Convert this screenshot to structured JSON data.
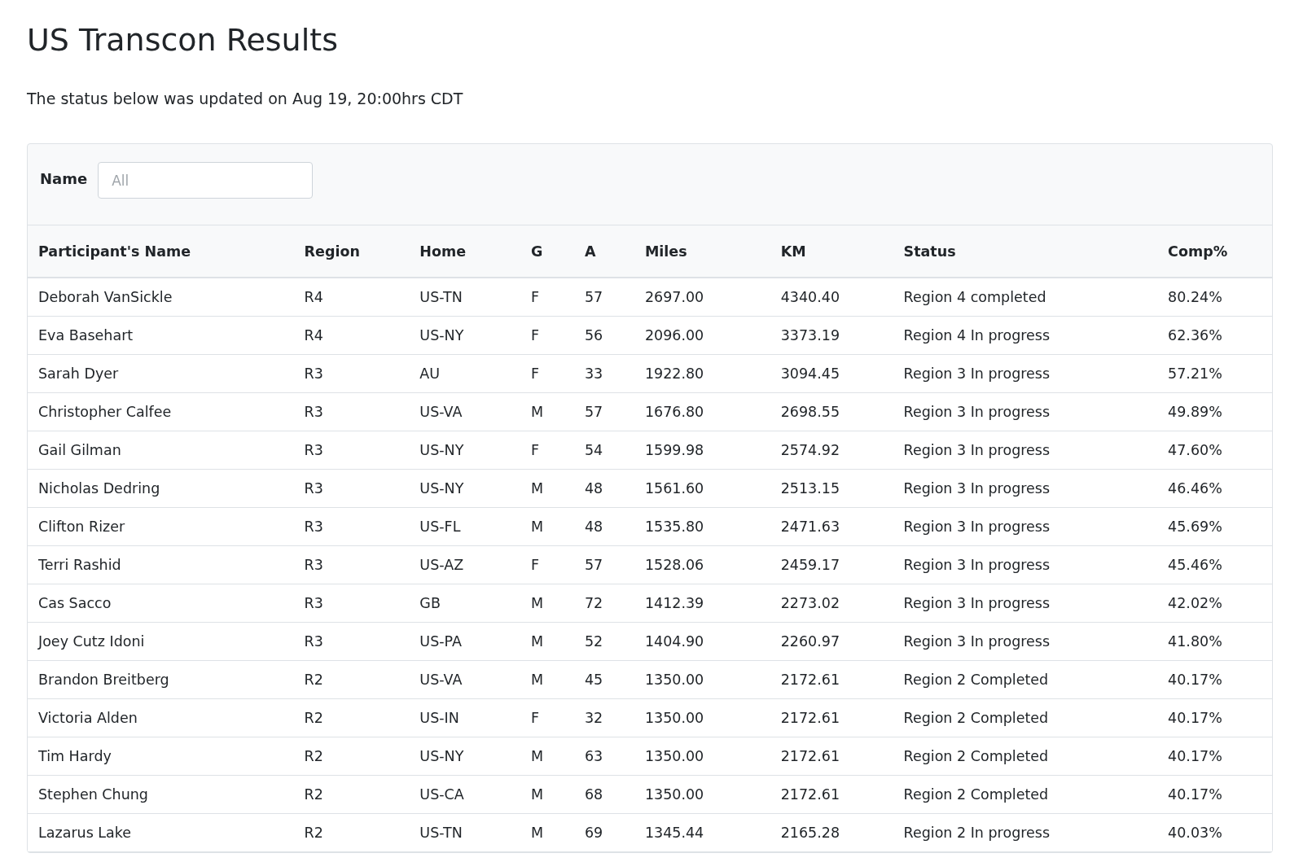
{
  "title": "US Transcon Results",
  "subtitle": "The status below was updated on Aug 19, 20:00hrs CDT",
  "filter": {
    "label": "Name",
    "placeholder": "All"
  },
  "table": {
    "columns": [
      "Participant's Name",
      "Region",
      "Home",
      "G",
      "A",
      "Miles",
      "KM",
      "Status",
      "Comp%"
    ],
    "rows": [
      [
        "Deborah VanSickle",
        "R4",
        "US-TN",
        "F",
        "57",
        "2697.00",
        "4340.40",
        "Region 4 completed",
        "80.24%"
      ],
      [
        "Eva Basehart",
        "R4",
        "US-NY",
        "F",
        "56",
        "2096.00",
        "3373.19",
        "Region 4 In progress",
        "62.36%"
      ],
      [
        "Sarah Dyer",
        "R3",
        "AU",
        "F",
        "33",
        "1922.80",
        "3094.45",
        "Region 3 In progress",
        "57.21%"
      ],
      [
        "Christopher Calfee",
        "R3",
        "US-VA",
        "M",
        "57",
        "1676.80",
        "2698.55",
        "Region 3 In progress",
        "49.89%"
      ],
      [
        "Gail Gilman",
        "R3",
        "US-NY",
        "F",
        "54",
        "1599.98",
        "2574.92",
        "Region 3 In progress",
        "47.60%"
      ],
      [
        "Nicholas Dedring",
        "R3",
        "US-NY",
        "M",
        "48",
        "1561.60",
        "2513.15",
        "Region 3 In progress",
        "46.46%"
      ],
      [
        "Clifton Rizer",
        "R3",
        "US-FL",
        "M",
        "48",
        "1535.80",
        "2471.63",
        "Region 3 In progress",
        "45.69%"
      ],
      [
        "Terri Rashid",
        "R3",
        "US-AZ",
        "F",
        "57",
        "1528.06",
        "2459.17",
        "Region 3 In progress",
        "45.46%"
      ],
      [
        "Cas Sacco",
        "R3",
        "GB",
        "M",
        "72",
        "1412.39",
        "2273.02",
        "Region 3 In progress",
        "42.02%"
      ],
      [
        "Joey Cutz Idoni",
        "R3",
        "US-PA",
        "M",
        "52",
        "1404.90",
        "2260.97",
        "Region 3 In progress",
        "41.80%"
      ],
      [
        "Brandon Breitberg",
        "R2",
        "US-VA",
        "M",
        "45",
        "1350.00",
        "2172.61",
        "Region 2 Completed",
        "40.17%"
      ],
      [
        "Victoria Alden",
        "R2",
        "US-IN",
        "F",
        "32",
        "1350.00",
        "2172.61",
        "Region 2 Completed",
        "40.17%"
      ],
      [
        "Tim Hardy",
        "R2",
        "US-NY",
        "M",
        "63",
        "1350.00",
        "2172.61",
        "Region 2 Completed",
        "40.17%"
      ],
      [
        "Stephen Chung",
        "R2",
        "US-CA",
        "M",
        "68",
        "1350.00",
        "2172.61",
        "Region 2 Completed",
        "40.17%"
      ],
      [
        "Lazarus Lake",
        "R2",
        "US-TN",
        "M",
        "69",
        "1345.44",
        "2165.28",
        "Region 2 In progress",
        "40.03%"
      ]
    ]
  }
}
